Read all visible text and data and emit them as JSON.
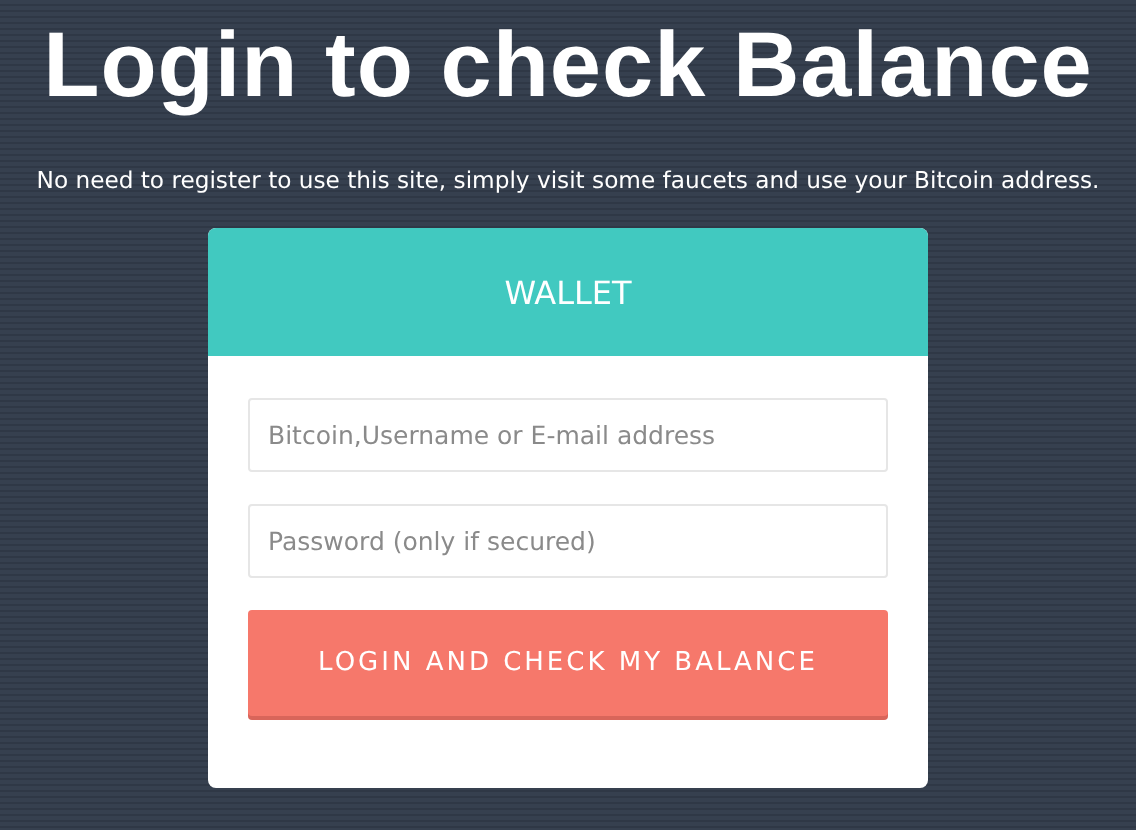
{
  "heading": "Login to check Balance",
  "subtitle": "No need to register to use this site, simply visit some faucets and use your Bitcoin address.",
  "card": {
    "title": "WALLET",
    "fields": [
      {
        "placeholder": "Bitcoin,Username or E-mail address"
      },
      {
        "placeholder": "Password (only if secured)"
      }
    ],
    "button": "LOGIN AND CHECK MY BALANCE"
  }
}
